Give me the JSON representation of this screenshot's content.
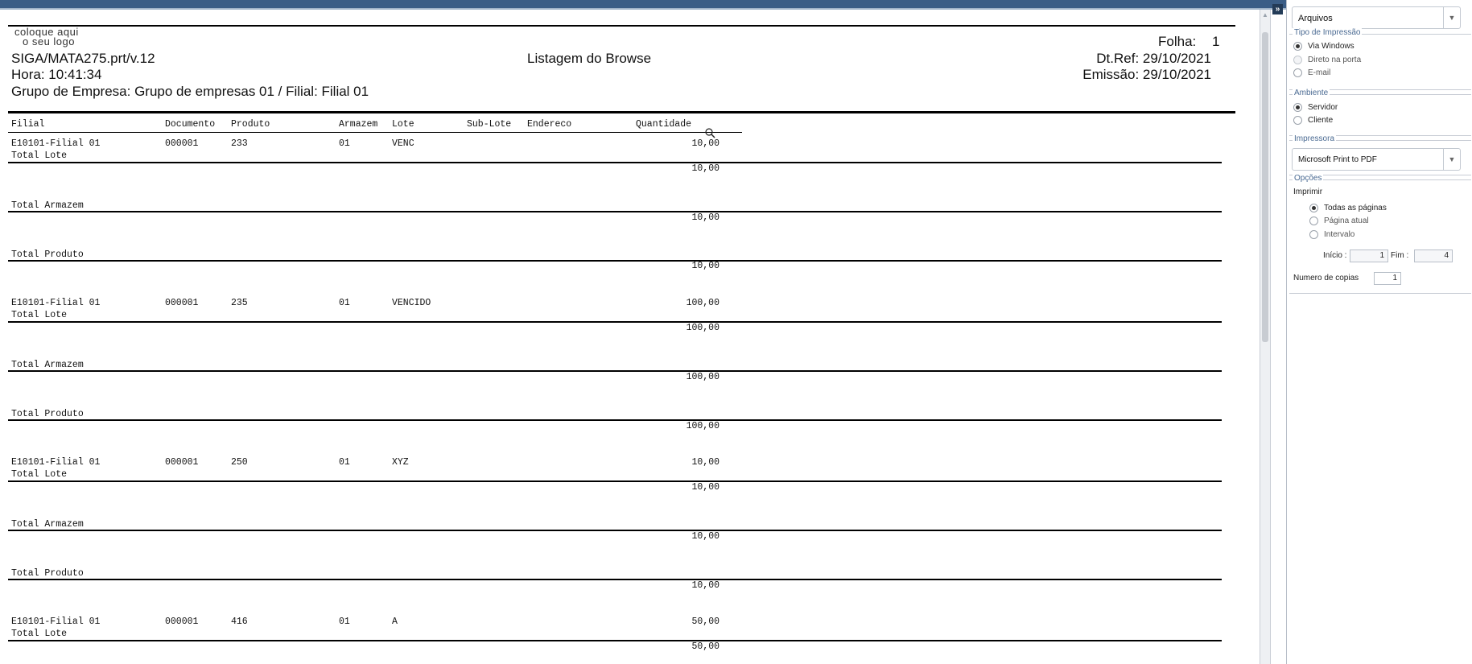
{
  "report": {
    "logo_line1": "coloque aqui",
    "logo_line2": "o seu logo",
    "program": "SIGA/MATA275.prt/v.12",
    "hora": "Hora: 10:41:34",
    "grupo": "Grupo de Empresa: Grupo de empresas 01 / Filial: Filial 01",
    "title": "Listagem do Browse",
    "folha_label": "Folha:",
    "folha_value": "1",
    "dtref": "Dt.Ref: 29/10/2021",
    "emissao": "Emissão: 29/10/2021",
    "columns": {
      "filial": "Filial",
      "documento": "Documento",
      "produto": "Produto",
      "armazem": "Armazem",
      "lote": "Lote",
      "sublote": "Sub-Lote",
      "endereco": "Endereco",
      "quantidade": "Quantidade"
    },
    "total_lote_label": "Total Lote",
    "total_armazem_label": "Total Armazem",
    "total_produto_label": "Total Produto",
    "groups": [
      {
        "filial": "E10101-Filial 01",
        "documento": "000001",
        "produto": "233",
        "armazem": "01",
        "lote": "VENC",
        "quantidade": "10,00",
        "total_lote": "10,00",
        "total_armazem": "10,00",
        "total_produto": "10,00"
      },
      {
        "filial": "E10101-Filial 01",
        "documento": "000001",
        "produto": "235",
        "armazem": "01",
        "lote": "VENCIDO",
        "quantidade": "100,00",
        "total_lote": "100,00",
        "total_armazem": "100,00",
        "total_produto": "100,00"
      },
      {
        "filial": "E10101-Filial 01",
        "documento": "000001",
        "produto": "250",
        "armazem": "01",
        "lote": "XYZ",
        "quantidade": "10,00",
        "total_lote": "10,00",
        "total_armazem": "10,00",
        "total_produto": "10,00"
      },
      {
        "filial": "E10101-Filial 01",
        "documento": "000001",
        "produto": "416",
        "armazem": "01",
        "lote": "A",
        "quantidade": "50,00",
        "total_lote": "50,00"
      }
    ]
  },
  "panel": {
    "output_select": "Arquivos",
    "tipo_title": "Tipo de Impressão",
    "tipo_options": [
      "Via Windows",
      "Direto na porta",
      "E-mail"
    ],
    "ambiente_title": "Ambiente",
    "ambiente_options": [
      "Servidor",
      "Cliente"
    ],
    "impressora_title": "Impressora",
    "impressora_value": "Microsoft Print to PDF",
    "opcoes_title": "Opções",
    "imprimir_label": "Imprimir",
    "imprimir_options": [
      "Todas as páginas",
      "Página atual",
      "Intervalo"
    ],
    "inicio_label": "Início :",
    "inicio_value": "1",
    "fim_label": "Fim :",
    "fim_value": "4",
    "copias_label": "Numero de copias",
    "copias_value": "1"
  }
}
